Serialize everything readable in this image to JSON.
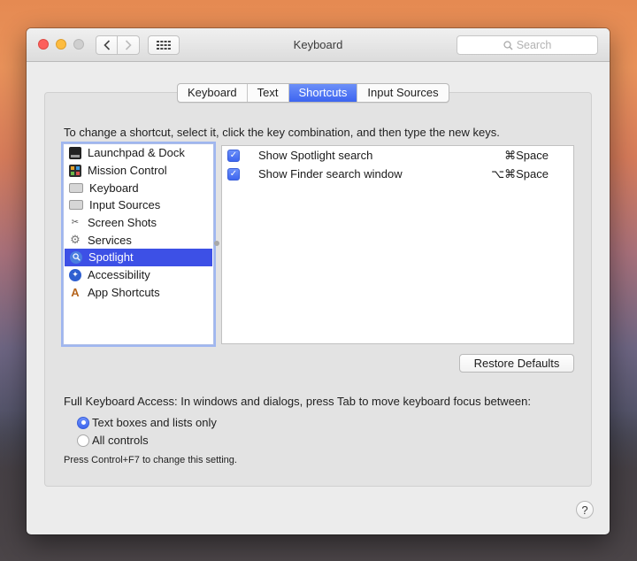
{
  "window": {
    "title": "Keyboard",
    "search_placeholder": "Search"
  },
  "tabs": [
    {
      "label": "Keyboard",
      "active": false
    },
    {
      "label": "Text",
      "active": false
    },
    {
      "label": "Shortcuts",
      "active": true
    },
    {
      "label": "Input Sources",
      "active": false
    }
  ],
  "instructions": "To change a shortcut, select it, click the key combination, and then type the new keys.",
  "categories": [
    {
      "label": "Launchpad & Dock",
      "icon": "launchpad-dock-icon",
      "selected": false
    },
    {
      "label": "Mission Control",
      "icon": "mission-control-icon",
      "selected": false
    },
    {
      "label": "Keyboard",
      "icon": "keyboard-icon",
      "selected": false
    },
    {
      "label": "Input Sources",
      "icon": "input-sources-icon",
      "selected": false
    },
    {
      "label": "Screen Shots",
      "icon": "screen-shots-icon",
      "selected": false
    },
    {
      "label": "Services",
      "icon": "gear-icon",
      "selected": false
    },
    {
      "label": "Spotlight",
      "icon": "spotlight-icon",
      "selected": true
    },
    {
      "label": "Accessibility",
      "icon": "accessibility-icon",
      "selected": false
    },
    {
      "label": "App Shortcuts",
      "icon": "app-shortcuts-icon",
      "selected": false
    }
  ],
  "shortcuts": [
    {
      "checked": true,
      "label": "Show Spotlight search",
      "key": "⌘Space"
    },
    {
      "checked": true,
      "label": "Show Finder search window",
      "key": "⌥⌘Space"
    }
  ],
  "restore_defaults_label": "Restore Defaults",
  "full_keyboard_access": {
    "description": "Full Keyboard Access: In windows and dialogs, press Tab to move keyboard focus between:",
    "options": [
      {
        "label": "Text boxes and lists only",
        "selected": true
      },
      {
        "label": "All controls",
        "selected": false
      }
    ],
    "hint": "Press Control+F7 to change this setting."
  },
  "help_label": "?",
  "colors": {
    "accent": "#3d65f0",
    "selection": "#3d50e6"
  }
}
